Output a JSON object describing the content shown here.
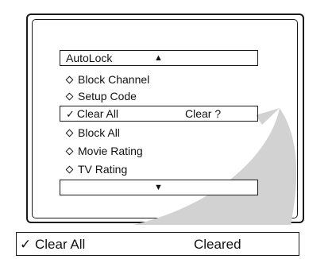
{
  "menu": {
    "header_label": "AutoLock",
    "header_arrow": "▲",
    "items": [
      {
        "label": "Block Channel",
        "marker": "diamond"
      },
      {
        "label": "Setup Code",
        "marker": "diamond"
      },
      {
        "label": "Clear All",
        "marker": "check",
        "status": "Clear ?"
      },
      {
        "label": "Block All",
        "marker": "diamond"
      },
      {
        "label": "Movie Rating",
        "marker": "diamond"
      },
      {
        "label": "TV Rating",
        "marker": "diamond"
      }
    ],
    "footer_arrow": "▼",
    "check_glyph": "✓"
  },
  "result": {
    "check_glyph": "✓",
    "label": "Clear All",
    "status": "Cleared"
  }
}
